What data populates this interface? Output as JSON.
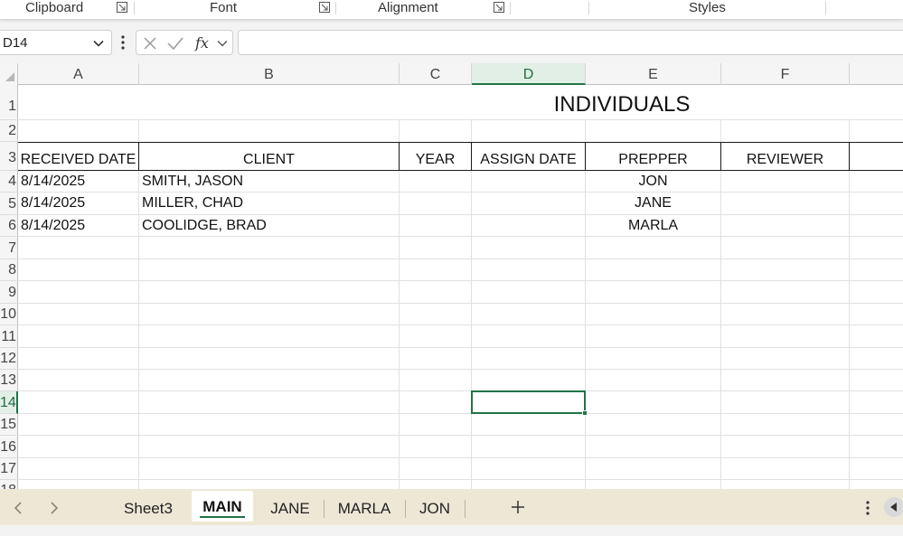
{
  "ribbon": {
    "groups": [
      "Clipboard",
      "Font",
      "Alignment",
      "Styles"
    ]
  },
  "formula_bar": {
    "name_box": "D14",
    "formula": ""
  },
  "grid": {
    "columns": [
      "A",
      "B",
      "C",
      "D",
      "E",
      "F"
    ],
    "selected_column": "D",
    "rows": [
      "1",
      "2",
      "3",
      "4",
      "5",
      "6",
      "7",
      "8",
      "9",
      "10",
      "11",
      "12",
      "13",
      "14",
      "15",
      "16",
      "17",
      "18"
    ],
    "selected_row": "14",
    "title": "INDIVIDUALS",
    "headers": [
      "RECEIVED DATE",
      "CLIENT",
      "YEAR",
      "ASSIGN DATE",
      "PREPPER",
      "REVIEWER"
    ],
    "data_rows": [
      {
        "received_date": "8/14/2025",
        "client": "SMITH, JASON",
        "year": "",
        "assign_date": "",
        "prepper": "JON",
        "reviewer": ""
      },
      {
        "received_date": "8/14/2025",
        "client": "MILLER, CHAD",
        "year": "",
        "assign_date": "",
        "prepper": "JANE",
        "reviewer": ""
      },
      {
        "received_date": "8/14/2025",
        "client": "COOLIDGE, BRAD",
        "year": "",
        "assign_date": "",
        "prepper": "MARLA",
        "reviewer": ""
      }
    ]
  },
  "sheet_tabs": {
    "tabs": [
      "Sheet3",
      "MAIN",
      "JANE",
      "MARLA",
      "JON"
    ],
    "active": "MAIN"
  },
  "colors": {
    "accent": "#217346",
    "tab_bar": "#ede7d6"
  }
}
